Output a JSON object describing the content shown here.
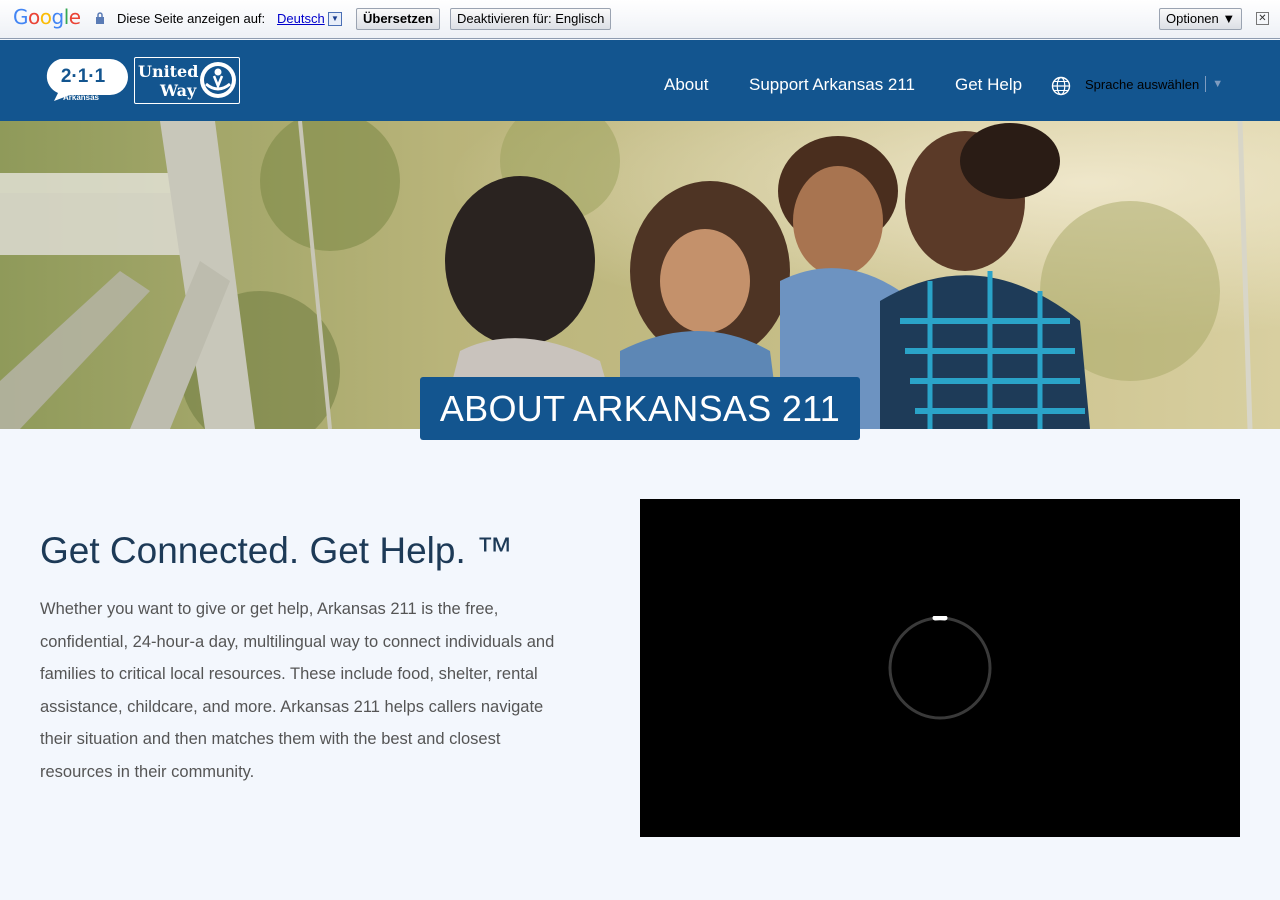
{
  "translate_bar": {
    "logo": "Google",
    "lock_icon": "lock-icon",
    "prompt": "Diese Seite anzeigen auf:",
    "language": "Deutsch",
    "translate_button": "Übersetzen",
    "disable_button": "Deaktivieren für: Englisch",
    "options_button": "Optionen ▼",
    "close": "✕"
  },
  "header": {
    "logo_211": {
      "number": "2·1·1",
      "state": "Arkansas"
    },
    "logo_uw": {
      "line1": "United",
      "line2": "Way"
    },
    "nav": [
      {
        "label": "About"
      },
      {
        "label": "Support Arkansas 211"
      },
      {
        "label": "Get Help"
      }
    ],
    "language_select": "Sprache auswählen",
    "language_caret": "▼",
    "globe_icon": "globe-icon"
  },
  "hero": {
    "title": "ABOUT ARKANSAS 211"
  },
  "content": {
    "heading": "Get Connected. Get Help. ™",
    "body": "Whether you want to give or get help, Arkansas 211 is the free, confidential, 24-hour-a day, multilingual way to connect individuals and families to critical local resources. These include food, shelter, rental assistance, childcare, and more. Arkansas 211 helps callers navigate their situation and then matches them with the best and closest resources in their community."
  },
  "colors": {
    "brand_blue": "#13558f",
    "page_bg": "#f3f7fd",
    "heading": "#1d3a57",
    "body_text": "#555555"
  }
}
